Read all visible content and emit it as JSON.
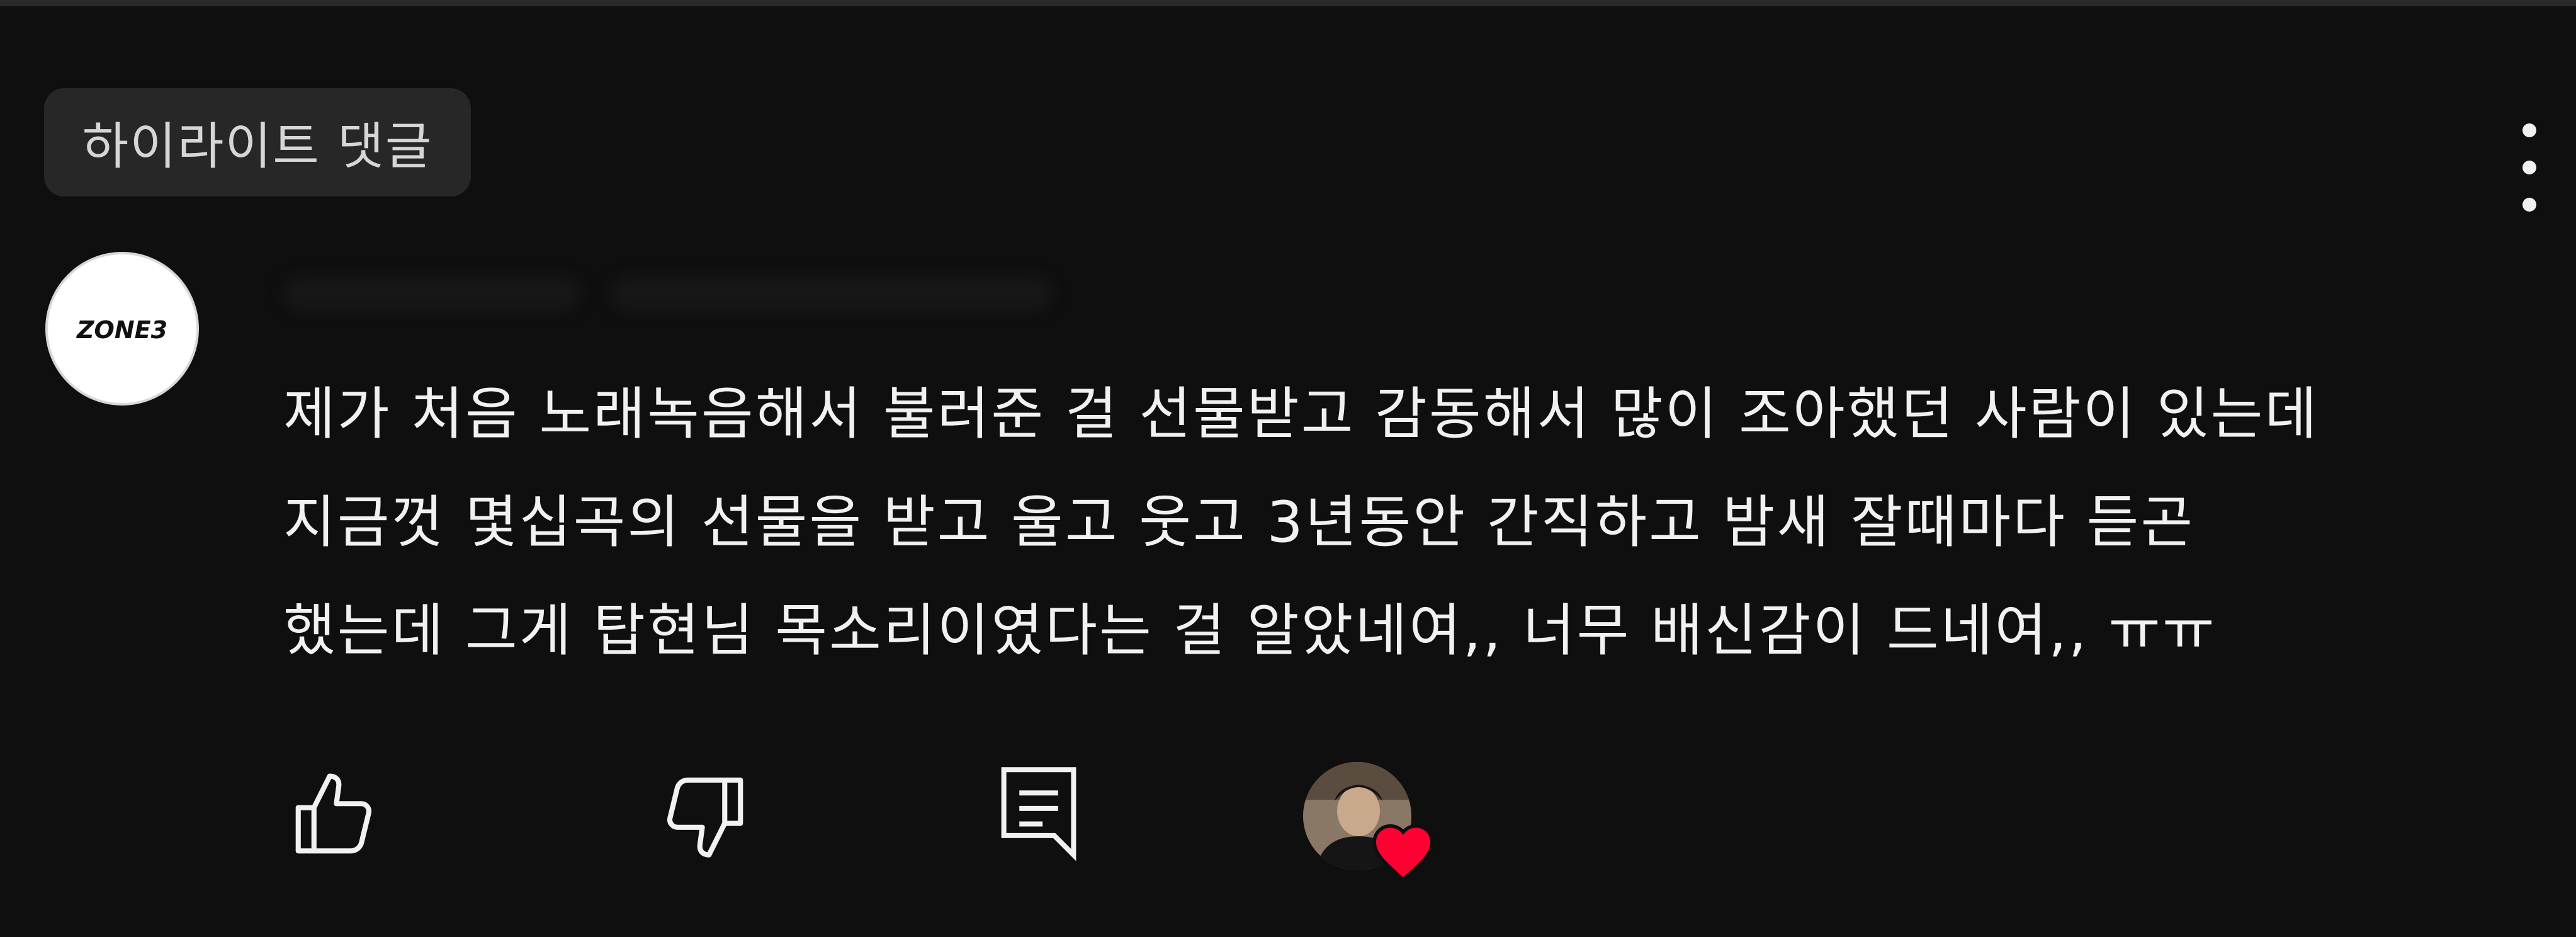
{
  "chip": {
    "label": "하이라이트 댓글"
  },
  "author": {
    "avatar_text": "ZONE3"
  },
  "comment": {
    "lines": [
      "제가 처음 노래녹음해서 불러준 걸 선물받고 감동해서 많이 조아했던 사람이 있는데",
      "지금껏 몇십곡의 선물을 받고 울고 웃고 3년동안 간직하고 밤새 잘때마다 듣곤",
      "했는데 그게 탑현님 목소리이였다는 걸 알았네여,, 너무 배신감이 드네여,, ㅠㅠ"
    ]
  },
  "actions": {
    "like_icon": "thumb-up-icon",
    "dislike_icon": "thumb-down-icon",
    "reply_icon": "comment-icon",
    "creator_heart_icon": "heart-icon"
  },
  "colors": {
    "background": "#0f0f0f",
    "chip_bg": "#272727",
    "text": "#f1f1f1",
    "heart": "#ff0033"
  }
}
